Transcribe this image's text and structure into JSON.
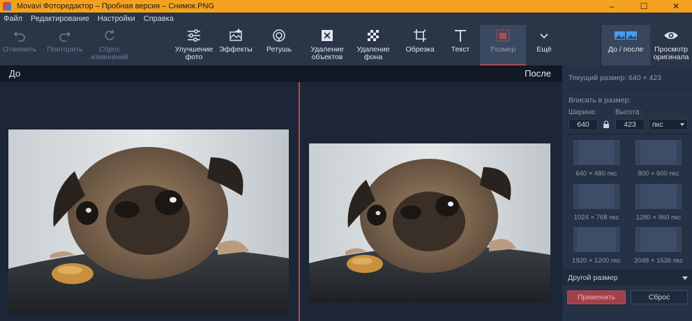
{
  "window": {
    "title": "Movavi Фоторедактор – Пробная версия – Снимок.PNG",
    "controls": {
      "minimize": "–",
      "maximize": "☐",
      "close": "✕"
    }
  },
  "menu": [
    {
      "label": "Файл"
    },
    {
      "label": "Редактирование"
    },
    {
      "label": "Настройки"
    },
    {
      "label": "Справка"
    }
  ],
  "toolbar": {
    "undo": "Отменить",
    "redo": "Повторить",
    "reset": "Сброс\nизменений",
    "enhance": "Улучшение\nфото",
    "effects": "Эффекты",
    "retouch": "Ретушь",
    "remove_objects": "Удаление\nобъектов",
    "remove_bg": "Удаление\nфона",
    "crop": "Обрезка",
    "text": "Текст",
    "resize": "Размер",
    "more": "Ещё",
    "before_after": "До / после",
    "view_original": "Просмотр\nоригинала"
  },
  "compare": {
    "before_label": "До",
    "after_label": "После"
  },
  "panel": {
    "current_size": "Текущий размер: 640 × 423",
    "fit_label": "Вписать в размер:",
    "width_label": "Ширина:",
    "height_label": "Высота:",
    "width_value": "640",
    "height_value": "423",
    "unit": "пкс",
    "presets": [
      {
        "label": "640 × 480 пкс"
      },
      {
        "label": "800 × 600 пкс"
      },
      {
        "label": "1024 × 768 пкс"
      },
      {
        "label": "1280 × 960 пкс"
      },
      {
        "label": "1920 × 1200 пкс"
      },
      {
        "label": "2048 × 1536 пкс"
      }
    ],
    "other_size": "Другой размер",
    "apply": "Применить",
    "reset": "Сброс"
  },
  "colors": {
    "titlebar": "#f4a21d",
    "accent": "#c8463e",
    "apply_button": "#a44049"
  }
}
